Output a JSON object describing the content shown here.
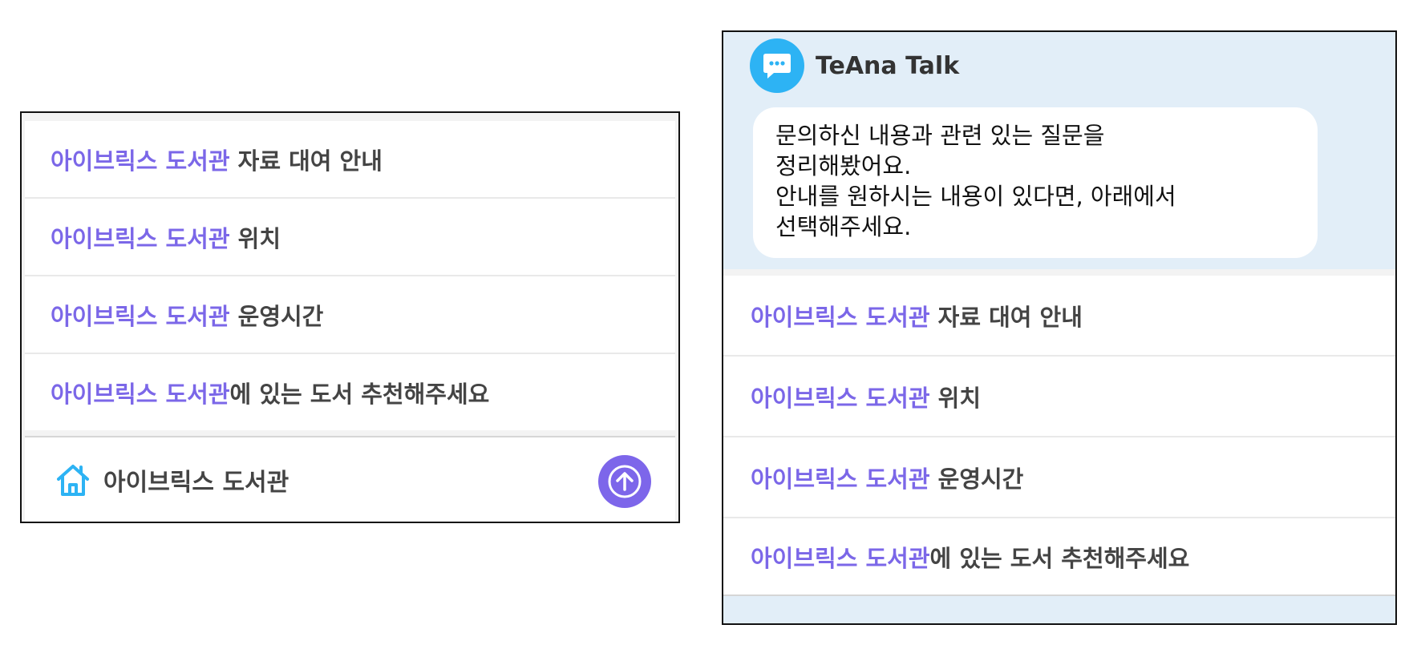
{
  "left_panel": {
    "suggestions": [
      {
        "highlight": "아이브릭스 도서관",
        "rest": " 자료 대여 안내"
      },
      {
        "highlight": "아이브릭스 도서관",
        "rest": " 위치"
      },
      {
        "highlight": "아이브릭스 도서관",
        "rest": " 운영시간"
      },
      {
        "highlight": "아이브릭스 도서관",
        "rest": "에 있는 도서 추천해주세요"
      }
    ],
    "footer": {
      "home_label": "아이브릭스 도서관",
      "home_icon": "home-icon",
      "send_icon": "arrow-up-icon"
    }
  },
  "right_panel": {
    "header": {
      "title": "TeAna Talk",
      "logo_icon": "chat-bubble-icon"
    },
    "bubble_lines": [
      "문의하신 내용과 관련 있는 질문을",
      "정리해봤어요.",
      "안내를 원하시는 내용이 있다면, 아래에서",
      "선택해주세요."
    ],
    "suggestions": [
      {
        "highlight": "아이브릭스 도서관",
        "rest": " 자료 대여 안내"
      },
      {
        "highlight": "아이브릭스 도서관",
        "rest": " 위치"
      },
      {
        "highlight": "아이브릭스 도서관",
        "rest": " 운영시간"
      },
      {
        "highlight": "아이브릭스 도서관",
        "rest": "에 있는 도서 추천해주세요"
      }
    ]
  },
  "colors": {
    "highlight": "#7b67e8",
    "send_button": "#7d66ea",
    "logo": "#2db3f4",
    "home_icon": "#2db3f4",
    "chat_bg": "#e2eef8"
  }
}
